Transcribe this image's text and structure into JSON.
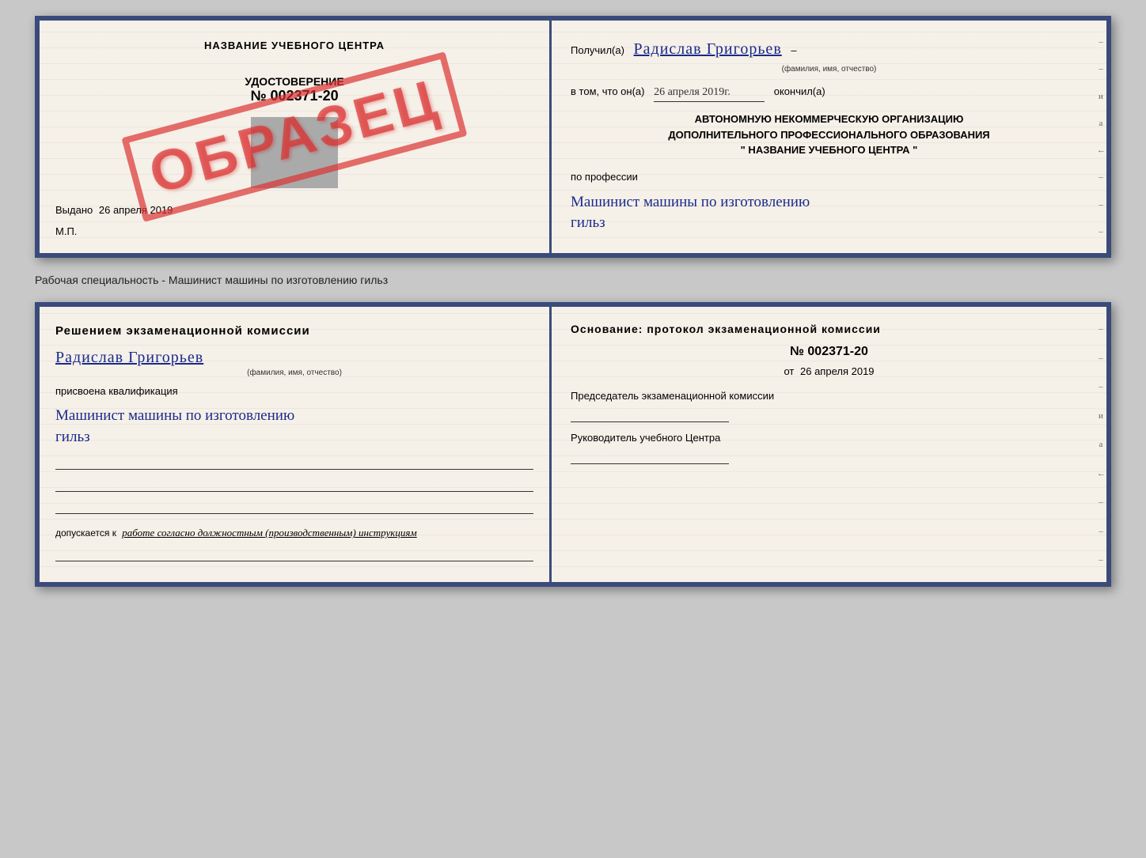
{
  "top_doc": {
    "left": {
      "center_title": "НАЗВАНИЕ УЧЕБНОГО ЦЕНТРА",
      "stamp": "ОБРАЗЕЦ",
      "cert_label": "УДОСТОВЕРЕНИЕ",
      "cert_number": "№ 002371-20",
      "vydano_prefix": "Выдано",
      "vydano_date": "26 апреля 2019",
      "mp": "М.П."
    },
    "right": {
      "poluchil_prefix": "Получил(а)",
      "name_handwritten": "Радислав Григорьев",
      "fio_subtitle": "(фамилия, имя, отчество)",
      "vtom_prefix": "в том, что он(а)",
      "date_handwritten": "26 апреля 2019г.",
      "okonchil": "окончил(а)",
      "org_line1": "АВТОНОМНУЮ НЕКОММЕРЧЕСКУЮ ОРГАНИЗАЦИЮ",
      "org_line2": "ДОПОЛНИТЕЛЬНОГО ПРОФЕССИОНАЛЬНОГО ОБРАЗОВАНИЯ",
      "org_name_quoted": "\" НАЗВАНИЕ УЧЕБНОГО ЦЕНТРА \"",
      "po_professii": "по профессии",
      "profession_handwritten": "Машинист машины по изготовлению",
      "profession_handwritten2": "гильз"
    }
  },
  "separator": "Рабочая специальность - Машинист машины по изготовлению гильз",
  "bottom_doc": {
    "left": {
      "resheniem_title": "Решением экзаменационной комиссии",
      "name_handwritten": "Радислав Григорьев",
      "fio_subtitle": "(фамилия, имя, отчество)",
      "prisvoena": "присвоена квалификация",
      "profession_handwritten": "Машинист машины по изготовлению",
      "profession_handwritten2": "гильз",
      "dopuskaetsya_prefix": "допускается к",
      "dopuskaetsya_text": "работе согласно должностным (производственным) инструкциям"
    },
    "right": {
      "osnovanie_title": "Основание: протокол экзаменационной комиссии",
      "protocol_number": "№ 002371-20",
      "protocol_date_prefix": "от",
      "protocol_date": "26 апреля 2019",
      "predsedatel_label": "Председатель экзаменационной комиссии",
      "rukovoditel_label": "Руководитель учебного Центра"
    }
  }
}
